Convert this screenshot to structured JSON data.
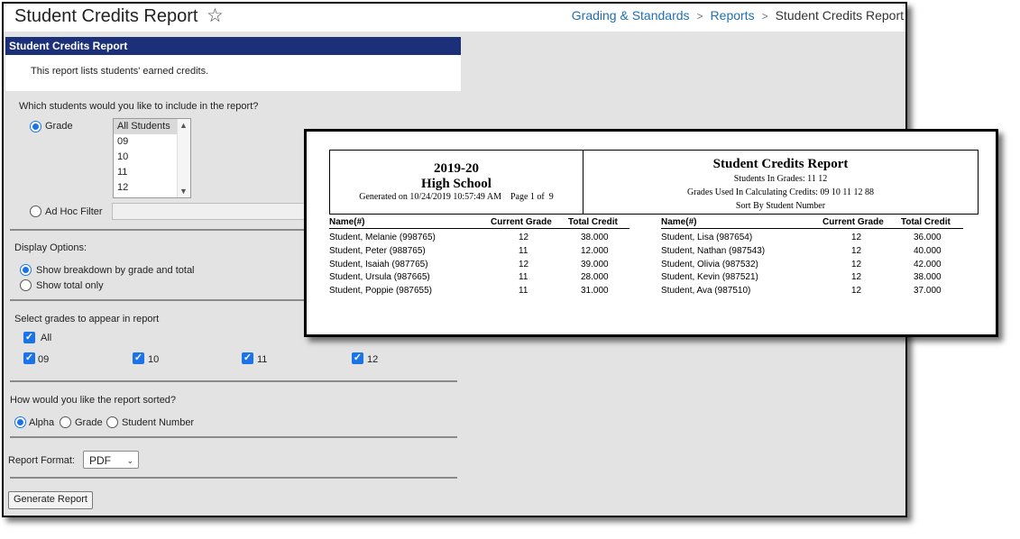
{
  "header": {
    "title": "Student Credits Report",
    "breadcrumb": [
      "Grading & Standards",
      "Reports",
      "Student Credits Report"
    ]
  },
  "info": {
    "bar_title": "Student Credits Report",
    "description": "This report lists students' earned credits."
  },
  "students_section": {
    "question": "Which students would you like to include in the report?",
    "grade_label": "Grade",
    "grade_options": [
      "All Students",
      "09",
      "10",
      "11",
      "12"
    ],
    "adhoc_label": "Ad Hoc Filter"
  },
  "display_options": {
    "label": "Display Options:",
    "options": [
      "Show breakdown by grade and total",
      "Show total only"
    ]
  },
  "grades_section": {
    "label": "Select grades to appear in report",
    "all_label": "All",
    "grades": [
      "09",
      "10",
      "11",
      "12"
    ]
  },
  "sort_section": {
    "question": "How would you like the report sorted?",
    "options": [
      "Alpha",
      "Grade",
      "Student Number"
    ]
  },
  "format": {
    "label": "Report Format:",
    "value": "PDF"
  },
  "generate_label": "Generate Report",
  "report": {
    "year": "2019-20",
    "school": "High School",
    "generated": "Generated on 10/24/2019 10:57:49 AM    Page 1 of  9",
    "title": "Student Credits Report",
    "students_in_grades": "Students In Grades: 11 12",
    "grades_used": "Grades Used In Calculating Credits: 09 10 11 12 88",
    "sort_by": "Sort By Student Number",
    "columns": [
      "Name(#)",
      "Current Grade",
      "Total Credit"
    ],
    "left_rows": [
      {
        "name": "Student, Melanie (998765)",
        "grade": "12",
        "credit": "38.000"
      },
      {
        "name": "Student, Peter (988765)",
        "grade": "11",
        "credit": "12.000"
      },
      {
        "name": "Student, Isaiah (987765)",
        "grade": "12",
        "credit": "39.000"
      },
      {
        "name": "Student, Ursula (987665)",
        "grade": "11",
        "credit": "28.000"
      },
      {
        "name": "Student, Poppie (987655)",
        "grade": "11",
        "credit": "31.000"
      }
    ],
    "right_rows": [
      {
        "name": "Student, Lisa (987654)",
        "grade": "12",
        "credit": "36.000"
      },
      {
        "name": "Student, Nathan (987543)",
        "grade": "12",
        "credit": "40.000"
      },
      {
        "name": "Student, Olivia (987532)",
        "grade": "12",
        "credit": "42.000"
      },
      {
        "name": "Student, Kevin (987521)",
        "grade": "12",
        "credit": "38.000"
      },
      {
        "name": "Student, Ava (987510)",
        "grade": "12",
        "credit": "37.000"
      }
    ]
  }
}
